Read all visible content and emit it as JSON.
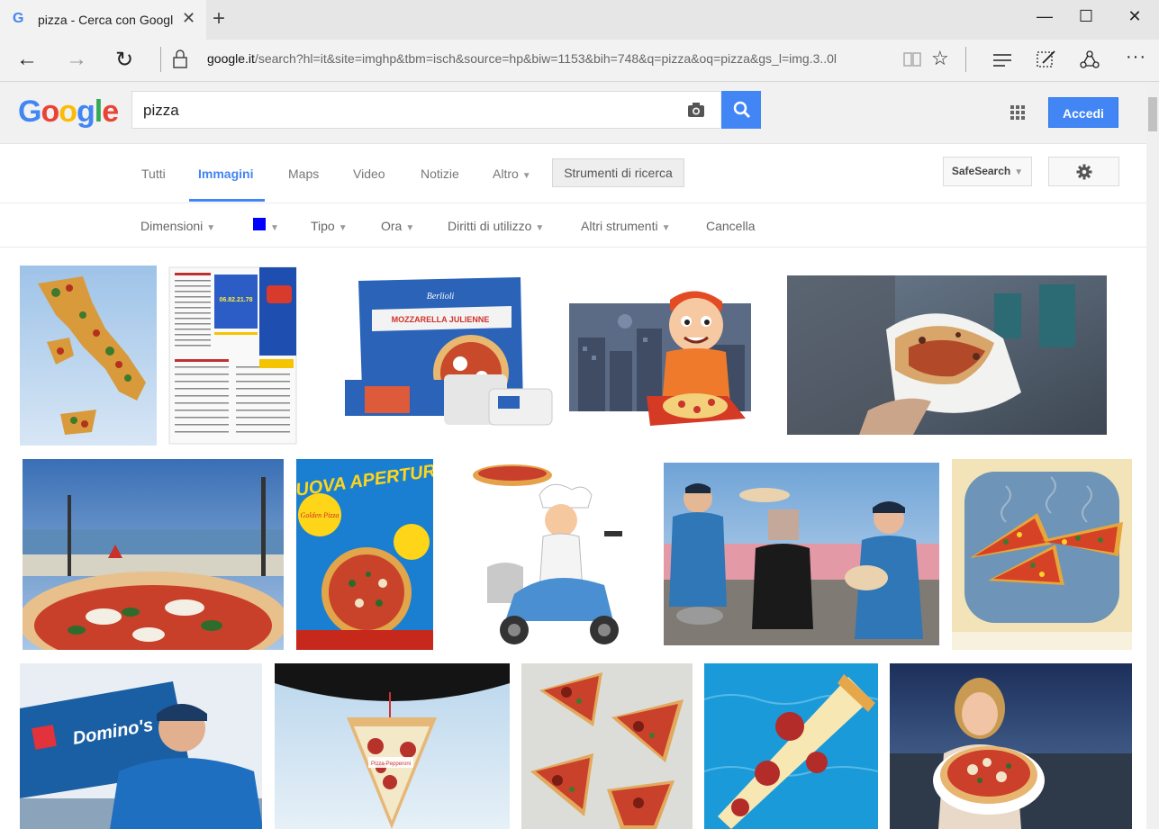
{
  "browser": {
    "tab_title": "pizza - Cerca con Googl",
    "favicon": "G",
    "url_host": "google.it",
    "url_rest": "/search?hl=it&site=imghp&tbm=isch&source=hp&biw=1153&bih=748&q=pizza&oq=pizza&gs_l=img.3..0l",
    "icons": [
      "back-icon",
      "forward-icon",
      "refresh-icon",
      "lock-icon",
      "reading-view-icon",
      "favorite-star-icon",
      "hub-icon",
      "web-note-icon",
      "share-icon",
      "more-icon"
    ]
  },
  "google": {
    "logo": [
      "G",
      "o",
      "o",
      "g",
      "l",
      "e"
    ],
    "logo_colors": [
      "#4285f4",
      "#ea4335",
      "#fbbc05",
      "#4285f4",
      "#34a853",
      "#ea4335"
    ],
    "query": "pizza",
    "signin_label": "Accedi"
  },
  "nav": {
    "tabs": [
      "Tutti",
      "Immagini",
      "Maps",
      "Video",
      "Notizie",
      "Altro"
    ],
    "active": "Immagini",
    "tools_button": "Strumenti di ricerca",
    "safesearch": "SafeSearch"
  },
  "tools": {
    "dimensioni": "Dimensioni",
    "tipo": "Tipo",
    "ora": "Ora",
    "diritti": "Diritti di utilizzo",
    "altri": "Altri strumenti",
    "cancella": "Cancella",
    "color_filter": "#0000ff"
  },
  "images": {
    "flyer_title": "NUOVA APERTURA",
    "flyer_logo": "Golden Pizza",
    "dominos_sign": "Domino's",
    "package_brand": "Berlioli",
    "package_product": "MOZZARELLA JULIENNE",
    "flyer_number": "06.82.21.78",
    "air_freshener_text": "Pizza-Pepperoni"
  }
}
